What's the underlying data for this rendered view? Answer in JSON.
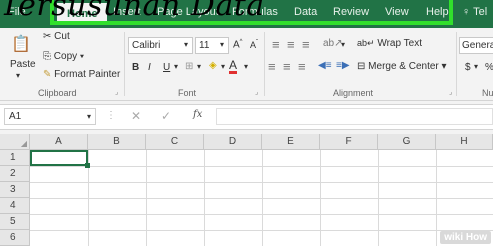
{
  "overlay_title": "Tersusunan Data",
  "tabs": [
    "File",
    "Home",
    "Insert",
    "Page Layout",
    "Formulas",
    "Data",
    "Review",
    "View",
    "Help",
    "Tel"
  ],
  "clipboard": {
    "cut": "Cut",
    "copy": "Copy",
    "paste": "Paste",
    "format_painter": "Format Painter",
    "label": "Clipboard"
  },
  "font": {
    "name": "Calibri",
    "size": "11",
    "label": "Font",
    "bold": "B",
    "italic": "I",
    "underline": "U"
  },
  "alignment": {
    "wrap_text": "Wrap Text",
    "merge_center": "Merge & Center",
    "label": "Alignment"
  },
  "number": {
    "format": "Genera",
    "currency": "$",
    "percent": "%",
    "label": "Nu"
  },
  "formula_bar": {
    "name_box": "A1",
    "fx": "fx",
    "value": ""
  },
  "columns": [
    "A",
    "B",
    "C",
    "D",
    "E",
    "F",
    "G",
    "H"
  ],
  "rows": [
    "1",
    "2",
    "3",
    "4",
    "5",
    "6"
  ],
  "watermark": "wiki How",
  "colors": {
    "ribbon_green": "#217346",
    "highlight": "#31e02c"
  }
}
